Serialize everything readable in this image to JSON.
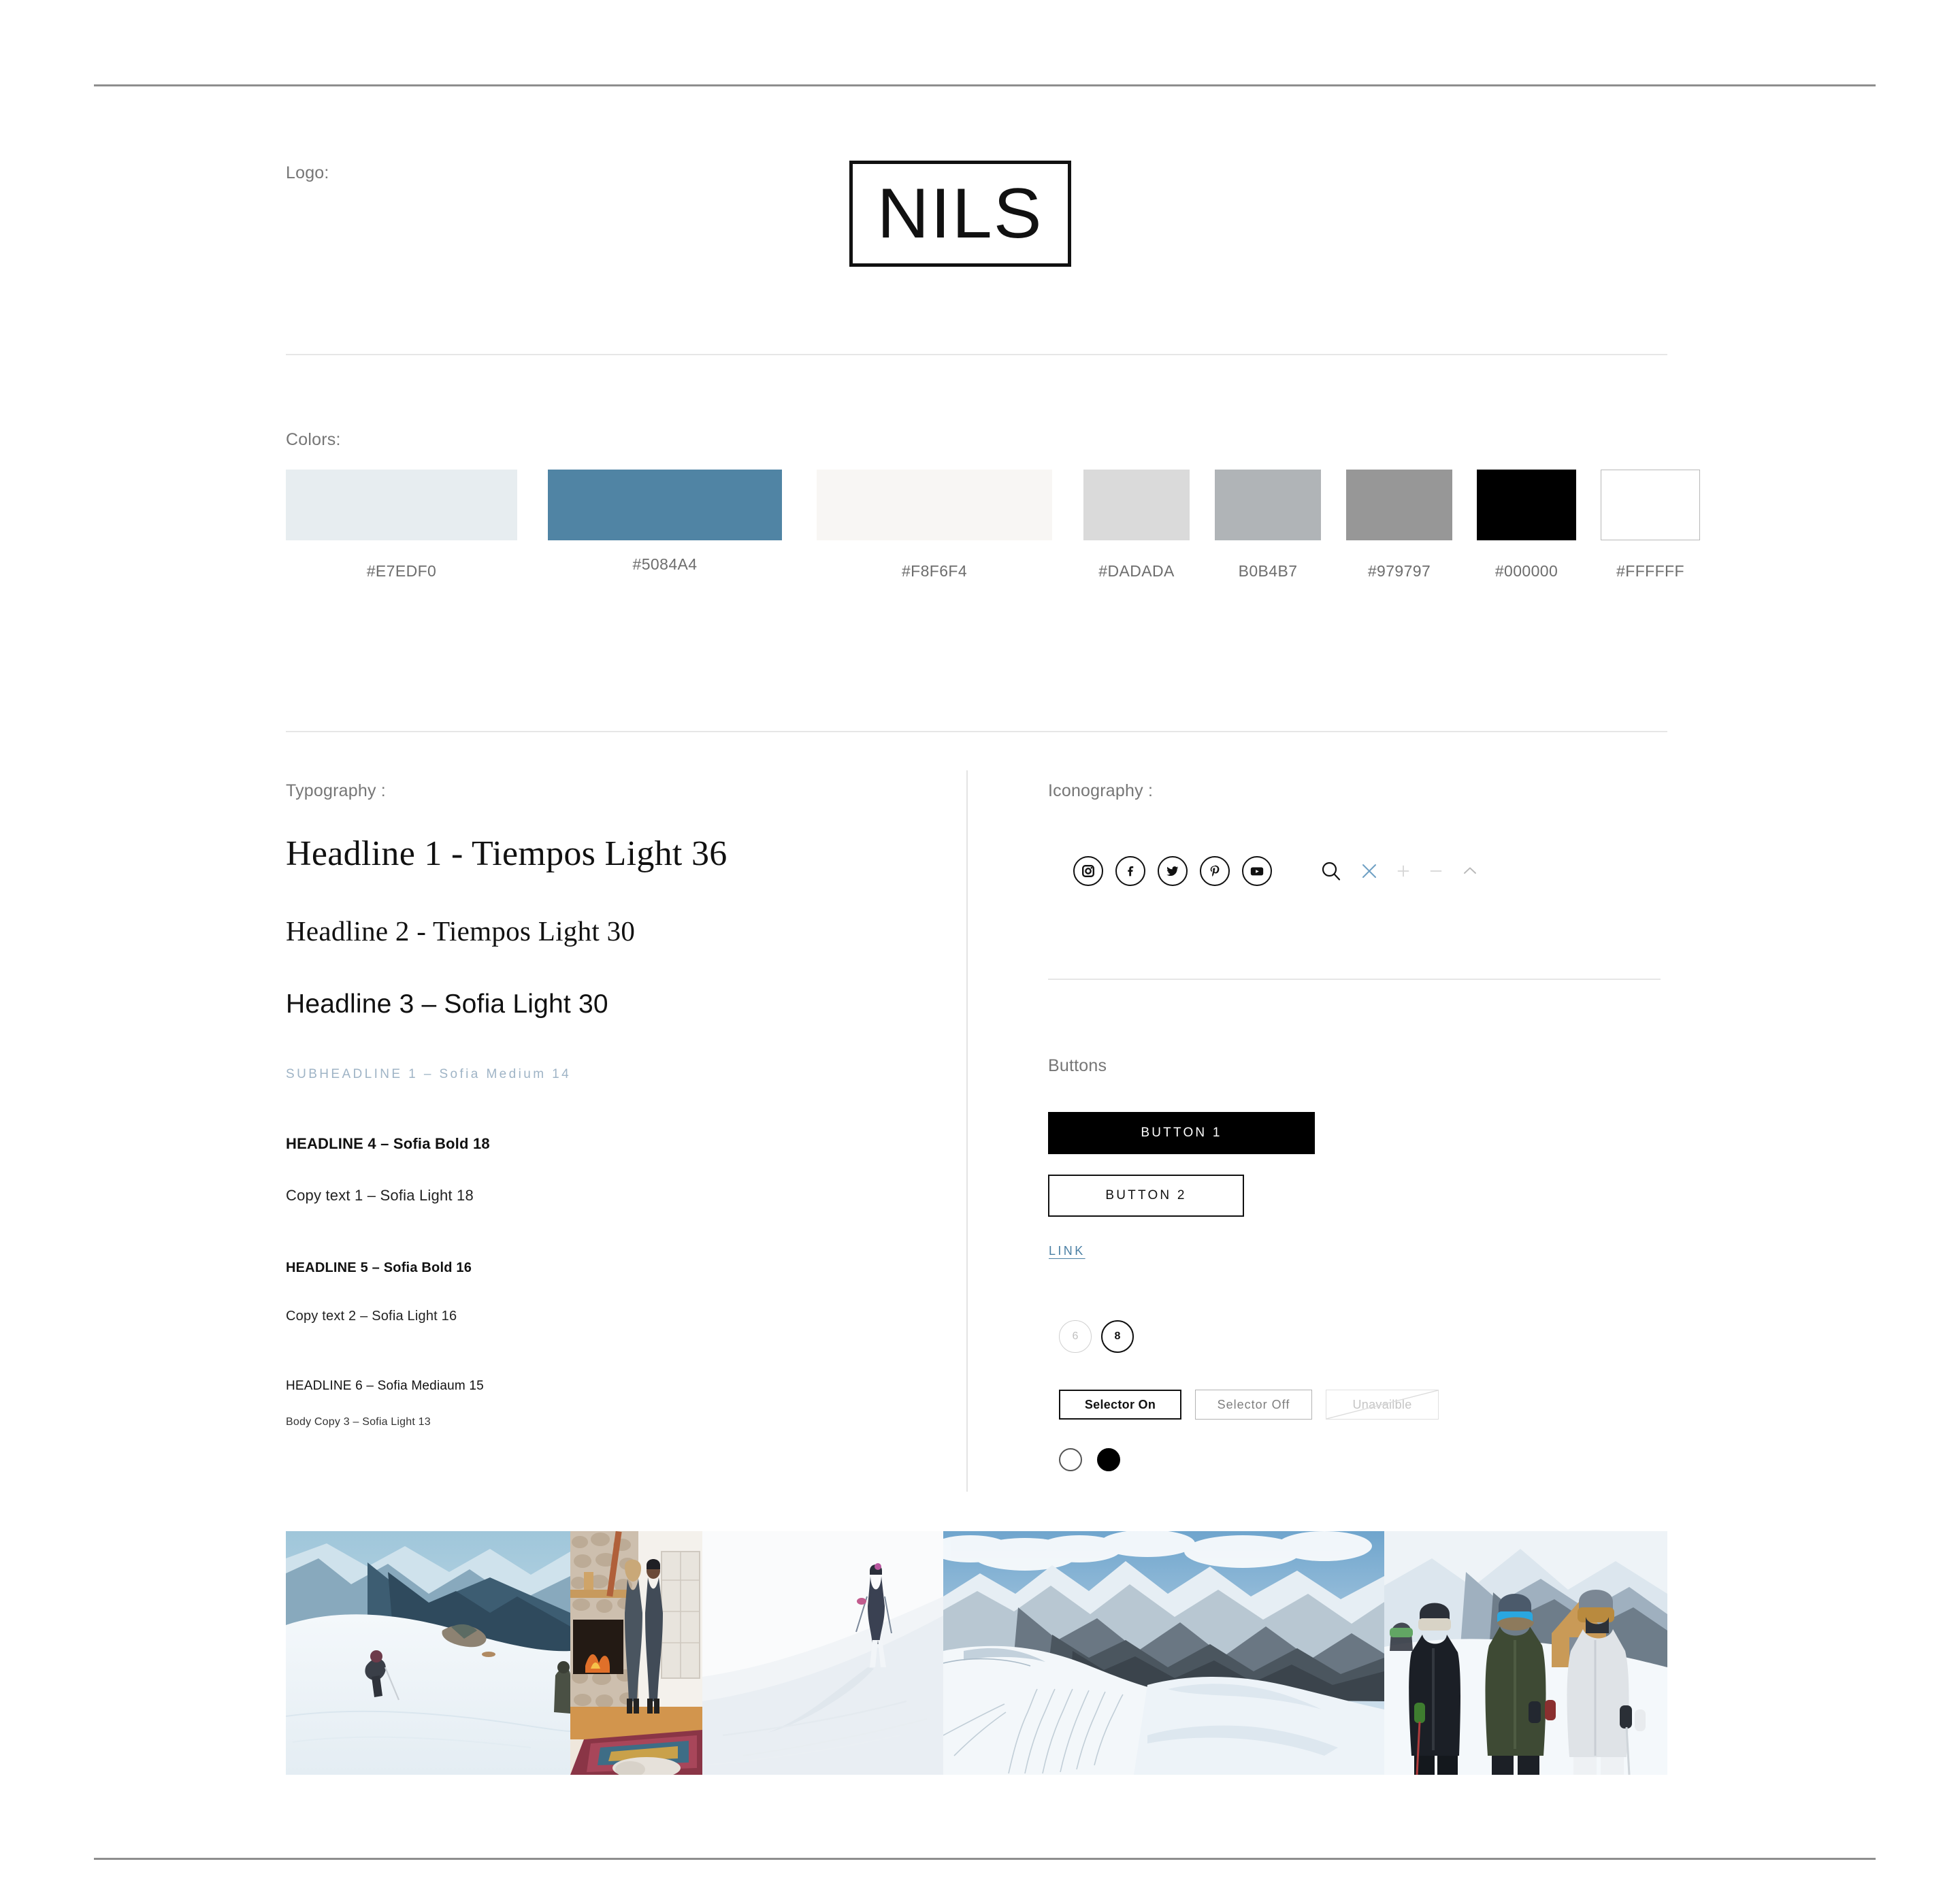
{
  "sections": {
    "logo_label": "Logo:",
    "colors_label": "Colors:",
    "typography_label": "Typography :",
    "iconography_label": "Iconography :",
    "buttons_label": "Buttons"
  },
  "logo": {
    "wordmark": "NILS"
  },
  "colors": {
    "swatches": [
      {
        "hex": "#E7EDF0",
        "label": "#E7EDF0",
        "fill": "#E7EDF0"
      },
      {
        "hex": "#5084A4",
        "label": "#5084A4",
        "fill": "#5084A4"
      },
      {
        "hex": "#F8F6F4",
        "label": "#F8F6F4",
        "fill": "#F8F6F4"
      },
      {
        "hex": "#DADADA",
        "label": "#DADADA",
        "fill": "#DADADA"
      },
      {
        "hex": "#B0B4B7",
        "label": "B0B4B7",
        "fill": "#B0B4B7"
      },
      {
        "hex": "#979797",
        "label": "#979797",
        "fill": "#979797"
      },
      {
        "hex": "#000000",
        "label": "#000000",
        "fill": "#000000"
      },
      {
        "hex": "#FFFFFF",
        "label": "#FFFFFF",
        "fill": "#FFFFFF"
      }
    ]
  },
  "typography": {
    "headline1": "Headline 1 - Tiempos Light 36",
    "headline2": "Headline 2 - Tiempos Light 30",
    "headline3": "Headline 3 – Sofia Light 30",
    "subheadline1": "SUBHEADLINE 1 – Sofia Medium 14",
    "headline4": "HEADLINE 4 – Sofia Bold 18",
    "copytext1": "Copy text 1 – Sofia Light 18",
    "headline5": "HEADLINE 5 – Sofia Bold 16",
    "copytext2": "Copy text 2 – Sofia Light 16",
    "headline6": "HEADLINE 6 – Sofia Mediaum 15",
    "bodycopy3": "Body Copy 3 – Sofia Light 13"
  },
  "iconography": {
    "social": [
      {
        "name": "instagram-icon"
      },
      {
        "name": "facebook-icon"
      },
      {
        "name": "twitter-icon"
      },
      {
        "name": "pinterest-icon"
      },
      {
        "name": "youtube-icon"
      }
    ],
    "utility": [
      {
        "name": "search-icon",
        "color": "#111111"
      },
      {
        "name": "close-x-icon",
        "color": "#6FA0C4"
      },
      {
        "name": "plus-icon",
        "color": "#D5D5D5"
      },
      {
        "name": "minus-icon",
        "color": "#D5D5D5"
      },
      {
        "name": "chevron-up-icon",
        "color": "#B9B9B9"
      }
    ]
  },
  "buttons": {
    "button1": "BUTTON 1",
    "button2": "BUTTON 2",
    "link": "LINK",
    "sizes": [
      {
        "value": "6",
        "state": "disabled"
      },
      {
        "value": "8",
        "state": "selected"
      }
    ],
    "selectors": [
      {
        "label": "Selector On",
        "state": "on"
      },
      {
        "label": "Selector  Off",
        "state": "off"
      },
      {
        "label": "Unavailble",
        "state": "unavailable"
      }
    ]
  },
  "photos": [
    {
      "name": "skiers-on-snowy-mountain-slope"
    },
    {
      "name": "two-women-by-lodge-fireplace"
    },
    {
      "name": "lone-skier-on-white-slope"
    },
    {
      "name": "panoramic-snowy-mountain-range-with-ski-tracks"
    },
    {
      "name": "three-skiers-in-goggles-and-jackets"
    }
  ]
}
